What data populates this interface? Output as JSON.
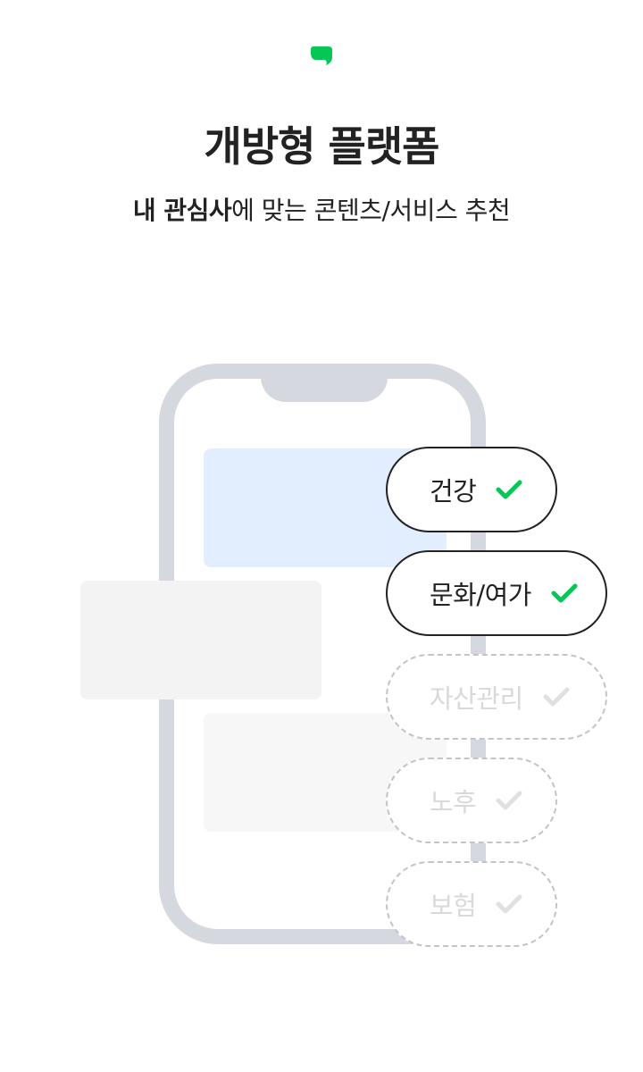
{
  "brand": {
    "logo_icon": "green-speech-bubble-icon",
    "accent_color": "#06c755"
  },
  "header": {
    "title": "개방형 플랫폼",
    "subtitle_strong": "내 관심사",
    "subtitle_rest": "에 맞는 콘텐츠/서비스 추천"
  },
  "chips": [
    {
      "label": "건강",
      "selected": true
    },
    {
      "label": "문화/여가",
      "selected": true
    },
    {
      "label": "자산관리",
      "selected": false
    },
    {
      "label": "노후",
      "selected": false
    },
    {
      "label": "보험",
      "selected": false
    }
  ],
  "colors": {
    "phone_frame": "#d5d8df",
    "selected_check": "#06c755",
    "unselected_check": "#e0e0e0",
    "card_blue": "#e2edfe"
  }
}
